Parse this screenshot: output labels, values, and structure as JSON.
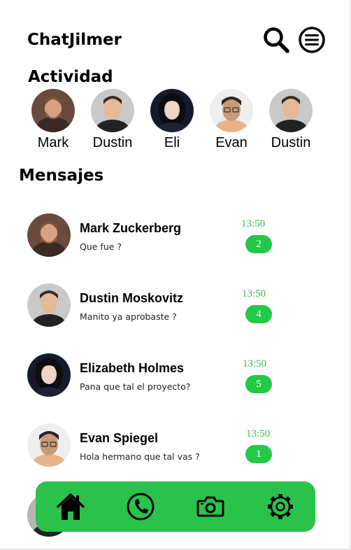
{
  "app": {
    "title": "ChatJilmer"
  },
  "header": {
    "search_icon": "search-icon",
    "menu_icon": "menu-icon"
  },
  "activity": {
    "title": "Actividad",
    "contacts": [
      {
        "name": "Mark"
      },
      {
        "name": "Dustin"
      },
      {
        "name": "Eli"
      },
      {
        "name": "Evan"
      },
      {
        "name": "Dustin"
      }
    ]
  },
  "messages": {
    "title": "Mensajes",
    "items": [
      {
        "name": "Mark Zuckerberg",
        "preview": "Que fue ?",
        "time": "13:50",
        "unread": "2"
      },
      {
        "name": "Dustin Moskovitz",
        "preview": "Manito ya aprobaste ?",
        "time": "13:50",
        "unread": "4"
      },
      {
        "name": "Elizabeth Holmes",
        "preview": "Pana que tal el proyecto?",
        "time": "13:50",
        "unread": "5"
      },
      {
        "name": "Evan Spiegel",
        "preview": "Hola hermano que tal vas ?",
        "time": "13:50",
        "unread": "1"
      }
    ]
  },
  "bottom_nav": {
    "items": [
      {
        "icon": "home-icon"
      },
      {
        "icon": "phone-icon"
      },
      {
        "icon": "camera-icon"
      },
      {
        "icon": "gear-icon"
      }
    ]
  },
  "colors": {
    "accent": "#2bc24b",
    "badge": "#22c946",
    "time_text": "#2fc24a"
  }
}
